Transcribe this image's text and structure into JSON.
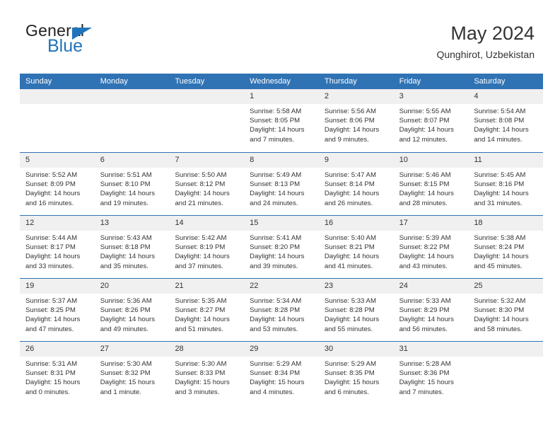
{
  "logo": {
    "text_top": "General",
    "text_bottom": "Blue",
    "triangle_color": "#1f74bb"
  },
  "header": {
    "title": "May 2024",
    "subtitle": "Qunghirot, Uzbekistan"
  },
  "theme": {
    "header_blue": "#3073b4",
    "daynum_band": "#f0f0f0",
    "text": "#333333"
  },
  "weekdays": [
    "Sunday",
    "Monday",
    "Tuesday",
    "Wednesday",
    "Thursday",
    "Friday",
    "Saturday"
  ],
  "weeks": [
    [
      {
        "day": "",
        "lines": []
      },
      {
        "day": "",
        "lines": []
      },
      {
        "day": "",
        "lines": []
      },
      {
        "day": "1",
        "lines": [
          "Sunrise: 5:58 AM",
          "Sunset: 8:05 PM",
          "Daylight: 14 hours and 7 minutes."
        ]
      },
      {
        "day": "2",
        "lines": [
          "Sunrise: 5:56 AM",
          "Sunset: 8:06 PM",
          "Daylight: 14 hours and 9 minutes."
        ]
      },
      {
        "day": "3",
        "lines": [
          "Sunrise: 5:55 AM",
          "Sunset: 8:07 PM",
          "Daylight: 14 hours and 12 minutes."
        ]
      },
      {
        "day": "4",
        "lines": [
          "Sunrise: 5:54 AM",
          "Sunset: 8:08 PM",
          "Daylight: 14 hours and 14 minutes."
        ]
      }
    ],
    [
      {
        "day": "5",
        "lines": [
          "Sunrise: 5:52 AM",
          "Sunset: 8:09 PM",
          "Daylight: 14 hours and 16 minutes."
        ]
      },
      {
        "day": "6",
        "lines": [
          "Sunrise: 5:51 AM",
          "Sunset: 8:10 PM",
          "Daylight: 14 hours and 19 minutes."
        ]
      },
      {
        "day": "7",
        "lines": [
          "Sunrise: 5:50 AM",
          "Sunset: 8:12 PM",
          "Daylight: 14 hours and 21 minutes."
        ]
      },
      {
        "day": "8",
        "lines": [
          "Sunrise: 5:49 AM",
          "Sunset: 8:13 PM",
          "Daylight: 14 hours and 24 minutes."
        ]
      },
      {
        "day": "9",
        "lines": [
          "Sunrise: 5:47 AM",
          "Sunset: 8:14 PM",
          "Daylight: 14 hours and 26 minutes."
        ]
      },
      {
        "day": "10",
        "lines": [
          "Sunrise: 5:46 AM",
          "Sunset: 8:15 PM",
          "Daylight: 14 hours and 28 minutes."
        ]
      },
      {
        "day": "11",
        "lines": [
          "Sunrise: 5:45 AM",
          "Sunset: 8:16 PM",
          "Daylight: 14 hours and 31 minutes."
        ]
      }
    ],
    [
      {
        "day": "12",
        "lines": [
          "Sunrise: 5:44 AM",
          "Sunset: 8:17 PM",
          "Daylight: 14 hours and 33 minutes."
        ]
      },
      {
        "day": "13",
        "lines": [
          "Sunrise: 5:43 AM",
          "Sunset: 8:18 PM",
          "Daylight: 14 hours and 35 minutes."
        ]
      },
      {
        "day": "14",
        "lines": [
          "Sunrise: 5:42 AM",
          "Sunset: 8:19 PM",
          "Daylight: 14 hours and 37 minutes."
        ]
      },
      {
        "day": "15",
        "lines": [
          "Sunrise: 5:41 AM",
          "Sunset: 8:20 PM",
          "Daylight: 14 hours and 39 minutes."
        ]
      },
      {
        "day": "16",
        "lines": [
          "Sunrise: 5:40 AM",
          "Sunset: 8:21 PM",
          "Daylight: 14 hours and 41 minutes."
        ]
      },
      {
        "day": "17",
        "lines": [
          "Sunrise: 5:39 AM",
          "Sunset: 8:22 PM",
          "Daylight: 14 hours and 43 minutes."
        ]
      },
      {
        "day": "18",
        "lines": [
          "Sunrise: 5:38 AM",
          "Sunset: 8:24 PM",
          "Daylight: 14 hours and 45 minutes."
        ]
      }
    ],
    [
      {
        "day": "19",
        "lines": [
          "Sunrise: 5:37 AM",
          "Sunset: 8:25 PM",
          "Daylight: 14 hours and 47 minutes."
        ]
      },
      {
        "day": "20",
        "lines": [
          "Sunrise: 5:36 AM",
          "Sunset: 8:26 PM",
          "Daylight: 14 hours and 49 minutes."
        ]
      },
      {
        "day": "21",
        "lines": [
          "Sunrise: 5:35 AM",
          "Sunset: 8:27 PM",
          "Daylight: 14 hours and 51 minutes."
        ]
      },
      {
        "day": "22",
        "lines": [
          "Sunrise: 5:34 AM",
          "Sunset: 8:28 PM",
          "Daylight: 14 hours and 53 minutes."
        ]
      },
      {
        "day": "23",
        "lines": [
          "Sunrise: 5:33 AM",
          "Sunset: 8:28 PM",
          "Daylight: 14 hours and 55 minutes."
        ]
      },
      {
        "day": "24",
        "lines": [
          "Sunrise: 5:33 AM",
          "Sunset: 8:29 PM",
          "Daylight: 14 hours and 56 minutes."
        ]
      },
      {
        "day": "25",
        "lines": [
          "Sunrise: 5:32 AM",
          "Sunset: 8:30 PM",
          "Daylight: 14 hours and 58 minutes."
        ]
      }
    ],
    [
      {
        "day": "26",
        "lines": [
          "Sunrise: 5:31 AM",
          "Sunset: 8:31 PM",
          "Daylight: 15 hours and 0 minutes."
        ]
      },
      {
        "day": "27",
        "lines": [
          "Sunrise: 5:30 AM",
          "Sunset: 8:32 PM",
          "Daylight: 15 hours and 1 minute."
        ]
      },
      {
        "day": "28",
        "lines": [
          "Sunrise: 5:30 AM",
          "Sunset: 8:33 PM",
          "Daylight: 15 hours and 3 minutes."
        ]
      },
      {
        "day": "29",
        "lines": [
          "Sunrise: 5:29 AM",
          "Sunset: 8:34 PM",
          "Daylight: 15 hours and 4 minutes."
        ]
      },
      {
        "day": "30",
        "lines": [
          "Sunrise: 5:29 AM",
          "Sunset: 8:35 PM",
          "Daylight: 15 hours and 6 minutes."
        ]
      },
      {
        "day": "31",
        "lines": [
          "Sunrise: 5:28 AM",
          "Sunset: 8:36 PM",
          "Daylight: 15 hours and 7 minutes."
        ]
      },
      {
        "day": "",
        "lines": []
      }
    ]
  ]
}
